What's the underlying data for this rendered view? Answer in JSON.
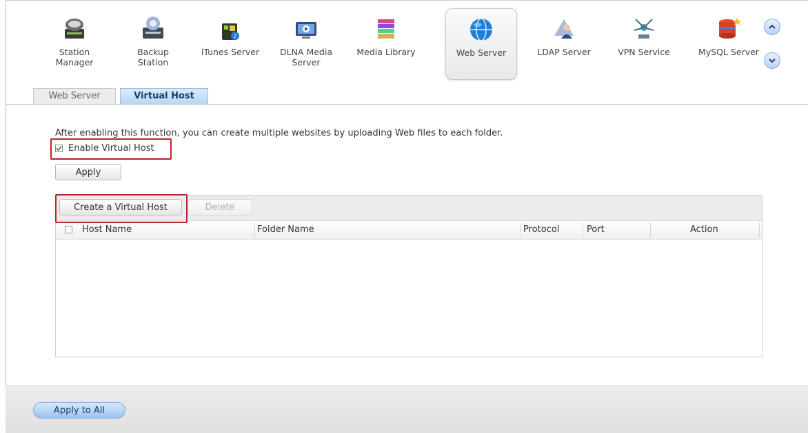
{
  "apps": [
    {
      "label": "Station\nManager",
      "icon": "station-manager-icon",
      "active": false
    },
    {
      "label": "Backup\nStation",
      "icon": "backup-station-icon",
      "active": false
    },
    {
      "label": "iTunes Server",
      "icon": "itunes-server-icon",
      "active": false
    },
    {
      "label": "DLNA Media\nServer",
      "icon": "dlna-media-server-icon",
      "active": false
    },
    {
      "label": "Media Library",
      "icon": "media-library-icon",
      "active": false
    },
    {
      "label": "Web Server",
      "icon": "web-server-globe-icon",
      "active": true
    },
    {
      "label": "LDAP Server",
      "icon": "ldap-server-icon",
      "active": false
    },
    {
      "label": "VPN Service",
      "icon": "vpn-service-icon",
      "active": false
    },
    {
      "label": "MySQL Server",
      "icon": "mysql-server-icon",
      "active": false
    }
  ],
  "scroll": {
    "up_icon": "chevron-up-icon",
    "down_icon": "chevron-down-icon"
  },
  "tabs": [
    {
      "label": "Web Server",
      "active": false
    },
    {
      "label": "Virtual Host",
      "active": true
    }
  ],
  "virtual_host": {
    "description": "After enabling this function, you can create multiple websites by uploading Web files to each folder.",
    "enable_label": "Enable Virtual Host",
    "enable_checked": true,
    "apply_label": "Apply",
    "create_label": "Create a Virtual Host",
    "delete_label": "Delete"
  },
  "table": {
    "columns": [
      "Host Name",
      "Folder Name",
      "Protocol",
      "Port",
      "Action"
    ],
    "rows": []
  },
  "footer": {
    "apply_all_label": "Apply to All"
  },
  "colors": {
    "highlight": "#b8262a",
    "active_tab": "#b5d7f7",
    "accent_button": "#9cc3f0"
  }
}
